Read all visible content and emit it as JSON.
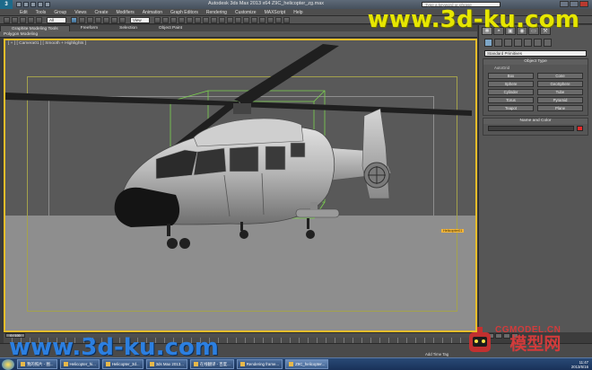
{
  "app": {
    "logo_text": "3",
    "title": "Autodesk 3ds Max  2013 x64    Z9C_helicopter_zg.max",
    "search_placeholder": "Type a keyword or phrase"
  },
  "menu": [
    "Edit",
    "Tools",
    "Group",
    "Views",
    "Create",
    "Modifiers",
    "Animation",
    "Graph Editors",
    "Rendering",
    "Customize",
    "MAXScript",
    "Help"
  ],
  "toolbar": {
    "selection_filter": "All",
    "view_dropdown": "View"
  },
  "ribbon": {
    "tabs": [
      "Graphite Modeling Tools",
      "Freeform",
      "Selection",
      "Object Paint"
    ],
    "active_tab": "Graphite Modeling Tools",
    "sub_label": "Polygon Modeling"
  },
  "viewport": {
    "label": "[ + ] [ Camera01 ] [ Smooth + Highlights ]",
    "object_tag": "Helicopter01"
  },
  "command_panel": {
    "tab_glyphs": [
      "✱",
      "◓",
      "▣",
      "◉",
      "▭",
      "⚒"
    ],
    "category_dropdown": "Standard Primitives",
    "object_type_title": "Object Type",
    "autogrid_label": "AutoGrid",
    "object_buttons": [
      "Box",
      "Cone",
      "Sphere",
      "GeoSphere",
      "Cylinder",
      "Tube",
      "Torus",
      "Pyramid",
      "Teapot",
      "Plane"
    ],
    "name_color_title": "Name and Color",
    "swatch_color": "#e52a2a"
  },
  "timeline": {
    "frame_readout": "0 / 100"
  },
  "status": {
    "hint": "Add Time Tag"
  },
  "taskbar": {
    "items": [
      "我的照片 - 图...",
      "Helicopter_hi...",
      "Helicopter_3d...",
      "3ds Max 2013...",
      "在线翻译 - 百度...",
      "Rendering frame...",
      "Z9C_helicopter..."
    ],
    "active_index": 6,
    "clock_time": "11:47",
    "clock_date": "2013/6/16"
  },
  "watermarks": {
    "top": "www.3d-ku.com",
    "bottom": "www.3d-ku.com",
    "brand_en": "CGMODEL.CN",
    "brand_cn": "模型网"
  },
  "colors": {
    "viewport_border": "#e7bd2a",
    "watermark_top": "#e6e600",
    "watermark_bottom": "#2c7fe0",
    "brand": "#d23b3b"
  }
}
